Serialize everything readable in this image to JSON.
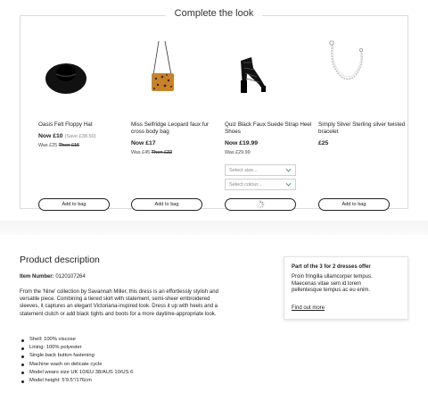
{
  "complete_the_look": {
    "title": "Complete the look",
    "products": [
      {
        "name": "Oasis Felt Floppy Hat",
        "price": "Now £10",
        "save": "(Save £38.50)",
        "was_prefix": "Was £25",
        "was_then": "Then £15",
        "image": "black-floppy-hat",
        "button": "Add to bag"
      },
      {
        "name": "Miss Selfridge Leopard faux fur cross body bag",
        "price": "Now £17",
        "was_prefix": "Was £45",
        "was_then": "Then £22",
        "image": "leopard-cross-body-bag",
        "button": "Add to bag"
      },
      {
        "name": "Quiz Black Faux Suede Strap Heel Shoes",
        "price": "Now £19.99",
        "was_prefix": "Was £29.99",
        "image": "black-strap-heel-shoes",
        "select_size": "Select size...",
        "select_colour": "Select colour...",
        "button_state": "loading-spinner"
      },
      {
        "name": "Simply Silver Sterling silver twisted bracelet",
        "price": "£25",
        "image": "silver-twisted-bracelet",
        "button": "Add to bag"
      }
    ]
  },
  "product_description": {
    "title": "Product description",
    "item_number_label": "Item Number:",
    "item_number": "0120107264",
    "description": "From the 'Nine' collection by Savannah Miller, this dress is an effortlessly stylish and versatile piece. Combining a tiered skirt with statement, semi-sheer embroidered sleeves, it captures an elegant Victoriana-inspired look. Dress it up with heels and a statement clutch or add black tights and boots for a more daytime-appropriate look.",
    "bullets": [
      "Shell: 100% viscose",
      "Lining: 100% polyester",
      "Single back button fastening",
      "Machine wash on delicate cycle",
      "Model wears size UK 10/EU 38/AUS 10/US 6",
      "Model height: 5'9.5\"/176cm"
    ]
  },
  "offer": {
    "title": "Part of the 3 for 2 dresses offer",
    "body": "Proin fringilla ullamcorper tempus. Maecenas vitae sem id lorem pellentesque tempus ac eu enim.",
    "link": "Find out more"
  },
  "colors": {
    "border": "#dcdcdc",
    "text": "#222222",
    "bag_leopard": "#c8832a",
    "chevron": "#2e9e6a"
  }
}
